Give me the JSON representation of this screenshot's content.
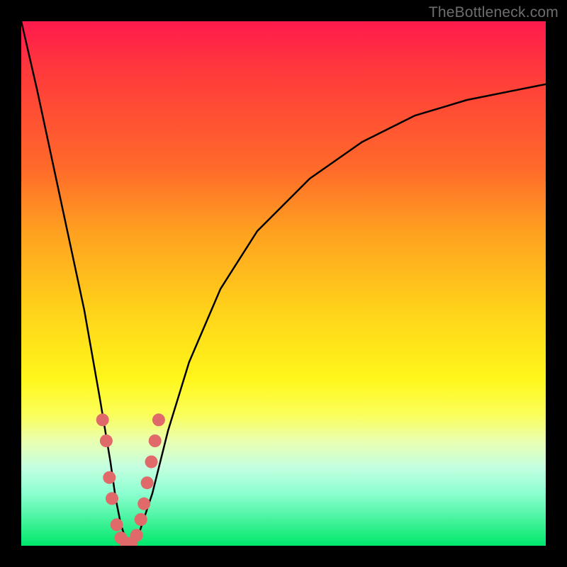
{
  "watermark": "TheBottleneck.com",
  "colors": {
    "curve_stroke": "#000000",
    "marker_fill": "#e06a6a",
    "marker_stroke": "#b94f4f",
    "gradient_top": "#ff1a4d",
    "gradient_bottom": "#00e86b",
    "frame": "#000000"
  },
  "chart_data": {
    "type": "line",
    "title": "",
    "xlabel": "",
    "ylabel": "",
    "xlim": [
      0,
      100
    ],
    "ylim": [
      0,
      100
    ],
    "grid": false,
    "legend": false,
    "series": [
      {
        "name": "bottleneck-curve",
        "comment": "V-shaped curve; y ≈ 100 at x=0, min y ≈ 0 near x ≈ 20, rises asymptotically toward y ≈ 88 at x=100. Values estimated from pixel positions.",
        "x": [
          0,
          3,
          6,
          9,
          12,
          15,
          17,
          18,
          19,
          20,
          21,
          22,
          23,
          25,
          28,
          32,
          38,
          45,
          55,
          65,
          75,
          85,
          95,
          100
        ],
        "y": [
          100,
          87,
          73,
          59,
          45,
          28,
          16,
          9,
          4,
          1,
          0,
          1,
          4,
          10,
          22,
          35,
          49,
          60,
          70,
          77,
          82,
          85,
          87,
          88
        ]
      }
    ],
    "markers": {
      "name": "highlighted-points",
      "comment": "Pink dots clustered near the curve bottom on both branches.",
      "points": [
        {
          "x": 15.5,
          "y": 24
        },
        {
          "x": 16.2,
          "y": 20
        },
        {
          "x": 16.8,
          "y": 13
        },
        {
          "x": 17.3,
          "y": 9
        },
        {
          "x": 18.2,
          "y": 4
        },
        {
          "x": 19.0,
          "y": 1.5
        },
        {
          "x": 20.0,
          "y": 0.5
        },
        {
          "x": 21.0,
          "y": 0.5
        },
        {
          "x": 22.0,
          "y": 2
        },
        {
          "x": 22.8,
          "y": 5
        },
        {
          "x": 23.4,
          "y": 8
        },
        {
          "x": 24.0,
          "y": 12
        },
        {
          "x": 24.8,
          "y": 16
        },
        {
          "x": 25.5,
          "y": 20
        },
        {
          "x": 26.2,
          "y": 24
        }
      ]
    }
  }
}
